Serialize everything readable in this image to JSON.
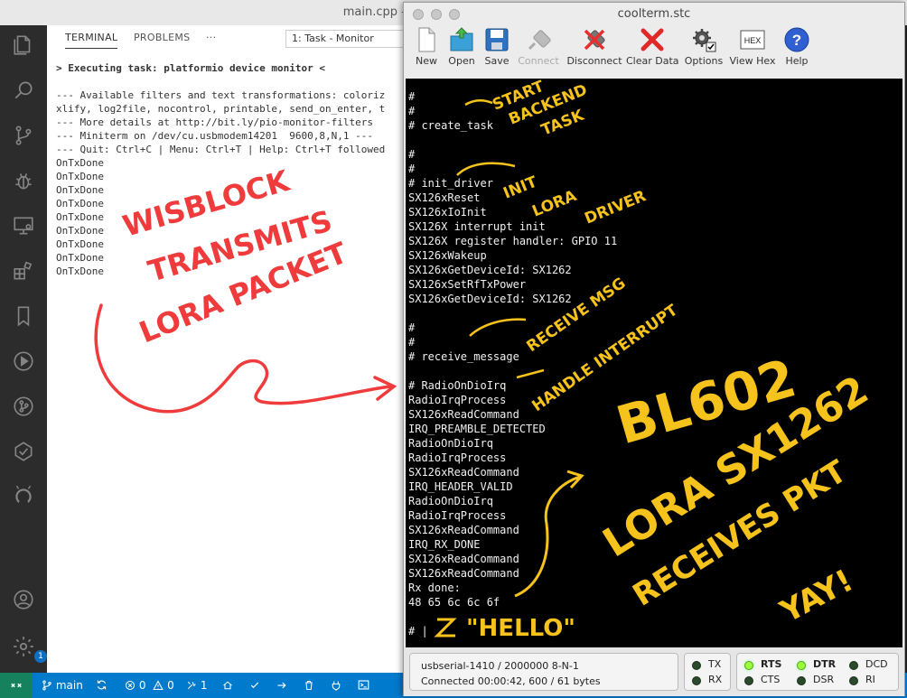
{
  "vscode": {
    "title": "main.cpp — wisblock-lora-transmitter",
    "tabs": [
      "TERMINAL",
      "PROBLEMS"
    ],
    "more": "···",
    "task_select": "1: Task - Monitor",
    "terminal_lines": [
      "> Executing task: platformio device monitor <",
      "",
      "--- Available filters and text transformations: coloriz",
      "xlify, log2file, nocontrol, printable, send_on_enter, t",
      "--- More details at http://bit.ly/pio-monitor-filters",
      "--- Miniterm on /dev/cu.usbmodem14201  9600,8,N,1 ---",
      "--- Quit: Ctrl+C | Menu: Ctrl+T | Help: Ctrl+T followed",
      "OnTxDone",
      "OnTxDone",
      "OnTxDone",
      "OnTxDone",
      "OnTxDone",
      "OnTxDone",
      "OnTxDone",
      "OnTxDone",
      "OnTxDone"
    ],
    "status": {
      "branch": "main",
      "errors": "0",
      "warnings": "0",
      "tools": "1",
      "settings_badge": "1"
    }
  },
  "coolterm": {
    "title": "coolterm.stc",
    "toolbar": [
      "New",
      "Open",
      "Save",
      "Connect",
      "Disconnect",
      "Clear Data",
      "Options",
      "View Hex",
      "Help"
    ],
    "hex_label": "HEX",
    "help_glyph": "?",
    "lines": [
      "#",
      "#",
      "# create_task",
      "",
      "#",
      "#",
      "# init_driver",
      "SX126xReset",
      "SX126xIoInit",
      "SX126X interrupt init",
      "SX126X register handler: GPIO 11",
      "SX126xWakeup",
      "SX126xGetDeviceId: SX1262",
      "SX126xSetRfTxPower",
      "SX126xGetDeviceId: SX1262",
      "",
      "#",
      "#",
      "# receive_message",
      "",
      "# RadioOnDioIrq",
      "RadioIrqProcess",
      "SX126xReadCommand",
      "IRQ_PREAMBLE_DETECTED",
      "RadioOnDioIrq",
      "RadioIrqProcess",
      "SX126xReadCommand",
      "IRQ_HEADER_VALID",
      "RadioOnDioIrq",
      "RadioIrqProcess",
      "SX126xReadCommand",
      "IRQ_RX_DONE",
      "SX126xReadCommand",
      "SX126xReadCommand",
      "Rx done:",
      "48 65 6c 6c 6f",
      "",
      "# |"
    ],
    "port": "usbserial-1410 / 2000000 8-N-1",
    "connected": "Connected 00:00:42, 600 / 61 bytes",
    "leds": {
      "tx": "TX",
      "rx": "RX",
      "rts": "RTS",
      "cts": "CTS",
      "dtr": "DTR",
      "dsr": "DSR",
      "dcd": "DCD",
      "ri": "RI"
    }
  },
  "annotations": {
    "red": [
      "WISBLOCK",
      "TRANSMITS",
      "LORA PACKET"
    ],
    "yellow_notes": [
      "START",
      "BACKEND",
      "TASK",
      "INIT",
      "LORA",
      "DRIVER",
      "RECEIVE MSG",
      "HANDLE INTERRUPT"
    ],
    "yellow_big": [
      "BL602",
      "LORA SX1262",
      "RECEIVES PKT",
      "YAY!"
    ],
    "hello": "\"HELLO\""
  }
}
